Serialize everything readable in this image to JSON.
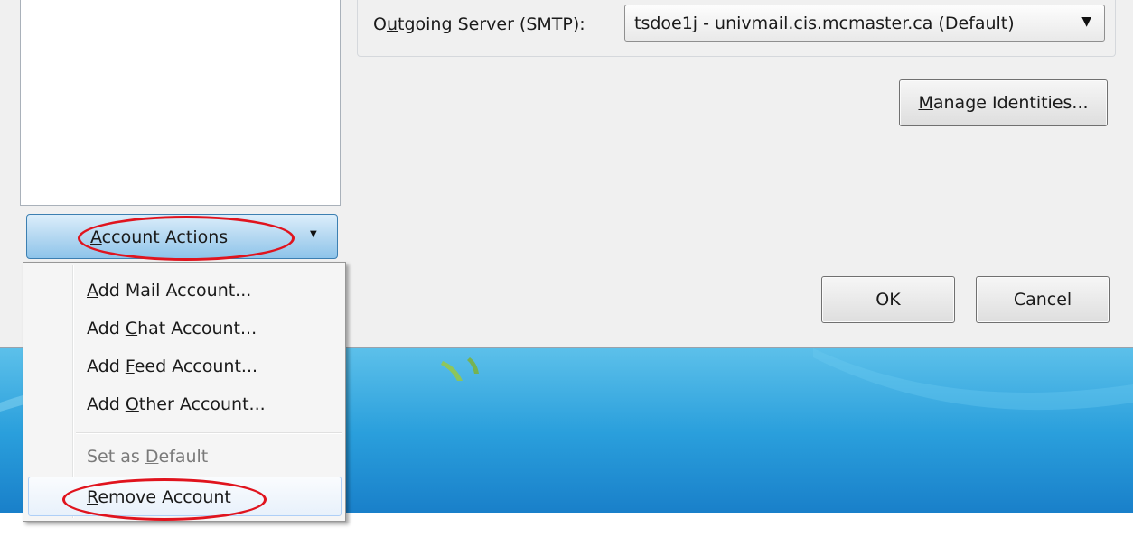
{
  "dialog": {
    "smtp_label_prefix": "O",
    "smtp_label_underline": "u",
    "smtp_label_suffix": "tgoing Server (SMTP):",
    "smtp_value": "tsdoe1j - univmail.cis.mcmaster.ca (Default)",
    "manage_identities_underline": "M",
    "manage_identities_rest": "anage Identities...",
    "ok_label": "OK",
    "cancel_label": "Cancel"
  },
  "account_actions": {
    "underline": "A",
    "rest": "ccount Actions"
  },
  "menu": {
    "items": [
      {
        "pre": "",
        "u": "A",
        "post": "dd Mail Account...",
        "enabled": true
      },
      {
        "pre": "Add ",
        "u": "C",
        "post": "hat Account...",
        "enabled": true
      },
      {
        "pre": "Add ",
        "u": "F",
        "post": "eed Account...",
        "enabled": true
      },
      {
        "pre": "Add ",
        "u": "O",
        "post": "ther Account...",
        "enabled": true
      },
      {
        "pre": "Set as ",
        "u": "D",
        "post": "efault",
        "enabled": false
      },
      {
        "pre": "",
        "u": "R",
        "post": "emove Account",
        "enabled": true
      }
    ]
  },
  "colors": {
    "annotation_red": "#e0141e",
    "button_blue": "#8ec4ea",
    "desktop_blue": "#2a9fdc"
  },
  "icons": {
    "dropdown_arrow": "chevron-down-icon",
    "actions_arrow": "chevron-down-icon"
  }
}
